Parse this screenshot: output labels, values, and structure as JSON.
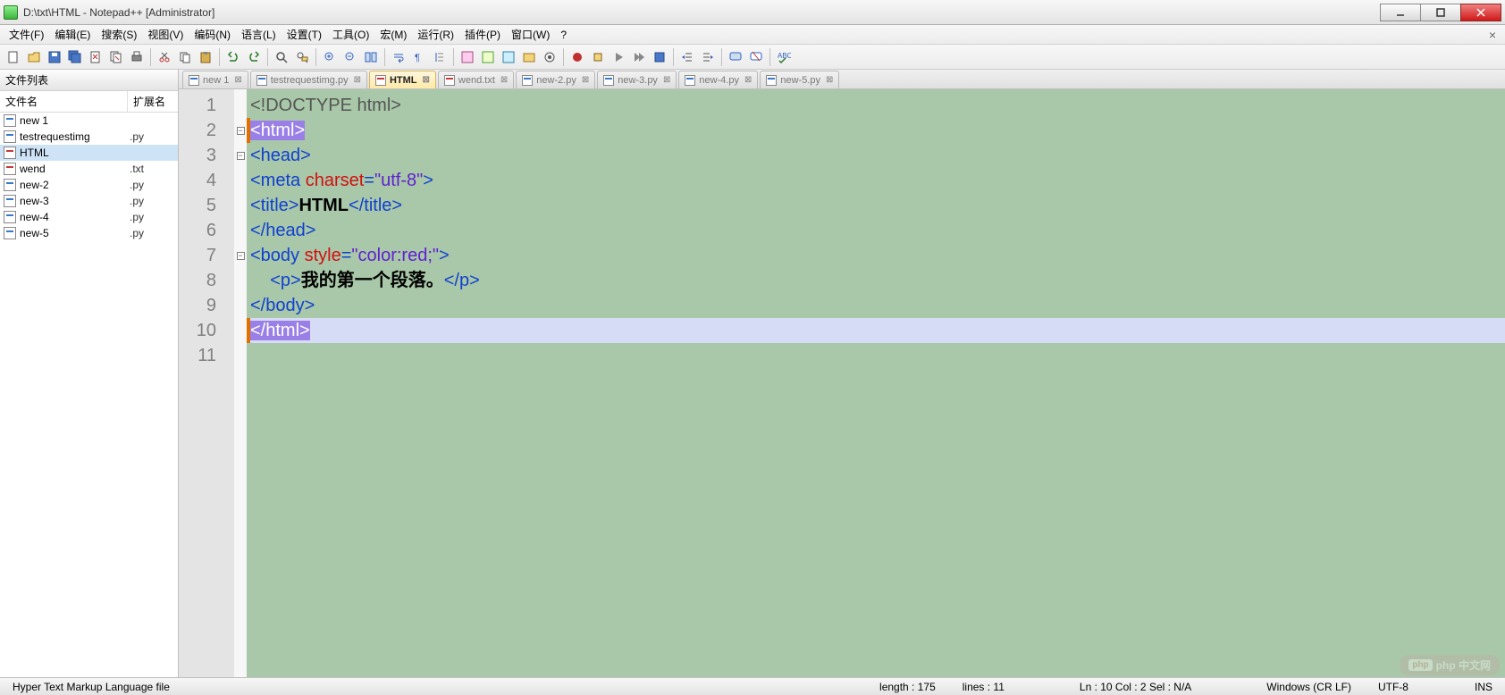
{
  "window": {
    "title": "D:\\txt\\HTML - Notepad++ [Administrator]"
  },
  "menu": [
    "文件(F)",
    "编辑(E)",
    "搜索(S)",
    "视图(V)",
    "编码(N)",
    "语言(L)",
    "设置(T)",
    "工具(O)",
    "宏(M)",
    "运行(R)",
    "插件(P)",
    "窗口(W)",
    "?"
  ],
  "sidebar": {
    "panel_title": "文件列表",
    "col_name": "文件名",
    "col_ext": "扩展名",
    "files": [
      {
        "name": "new 1",
        "ext": "",
        "type": "py",
        "selected": false
      },
      {
        "name": "testrequestimg",
        "ext": ".py",
        "type": "py",
        "selected": false
      },
      {
        "name": "HTML",
        "ext": "",
        "type": "txt",
        "selected": true
      },
      {
        "name": "wend",
        "ext": ".txt",
        "type": "txt",
        "selected": false
      },
      {
        "name": "new-2",
        "ext": ".py",
        "type": "py",
        "selected": false
      },
      {
        "name": "new-3",
        "ext": ".py",
        "type": "py",
        "selected": false
      },
      {
        "name": "new-4",
        "ext": ".py",
        "type": "py",
        "selected": false
      },
      {
        "name": "new-5",
        "ext": ".py",
        "type": "py",
        "selected": false
      }
    ]
  },
  "tabs": [
    {
      "label": "new 1",
      "type": "py",
      "active": false,
      "close": "⊠"
    },
    {
      "label": "testrequestimg.py",
      "type": "py",
      "active": false,
      "close": "⊠"
    },
    {
      "label": "HTML",
      "type": "txt",
      "active": true,
      "close": "⊠"
    },
    {
      "label": "wend.txt",
      "type": "txt",
      "active": false,
      "close": "⊠"
    },
    {
      "label": "new-2.py",
      "type": "py",
      "active": false,
      "close": "⊠"
    },
    {
      "label": "new-3.py",
      "type": "py",
      "active": false,
      "close": "⊠"
    },
    {
      "label": "new-4.py",
      "type": "py",
      "active": false,
      "close": "⊠"
    },
    {
      "label": "new-5.py",
      "type": "py",
      "active": false,
      "close": "⊠"
    }
  ],
  "code": {
    "lines": [
      {
        "n": "1",
        "html": "<span class='t-gray'>&lt;!DOCTYPE html&gt;</span>"
      },
      {
        "n": "2",
        "fold": true,
        "marker": true,
        "html": "<span class='hlpair'>&lt;</span><span class='t-blue' style='background:#9a80e6;color:#fff'>html</span><span class='hlpair'>&gt;</span>"
      },
      {
        "n": "3",
        "fold": true,
        "html": "<span class='t-blue'>&lt;head&gt;</span>"
      },
      {
        "n": "4",
        "html": "<span class='t-blue'>&lt;meta </span><span class='t-red'>charset</span><span class='t-blue'>=</span><span class='t-purple'>\"utf-8\"</span><span class='t-blue'>&gt;</span>"
      },
      {
        "n": "5",
        "html": "<span class='t-blue'>&lt;title&gt;</span><span class='t-black'>HTML</span><span class='t-blue'>&lt;/title&gt;</span>"
      },
      {
        "n": "6",
        "html": "<span class='t-blue'>&lt;/head&gt;</span>"
      },
      {
        "n": "7",
        "fold": true,
        "html": "<span class='t-blue'>&lt;body </span><span class='t-red'>style</span><span class='t-blue'>=</span><span class='t-purple'>\"color:red;\"</span><span class='t-blue'>&gt;</span>"
      },
      {
        "n": "8",
        "html": "    <span class='t-blue'>&lt;p&gt;</span><span class='t-black'>我的第一个段落。</span><span class='t-blue'>&lt;/p&gt;</span>"
      },
      {
        "n": "9",
        "html": "<span class='t-blue'>&lt;/body&gt;</span>"
      },
      {
        "n": "10",
        "hl": true,
        "marker": true,
        "html": "<span class='hlpair'>&lt;/</span><span style='background:#9a80e6;color:#fff'>html</span><span class='hlpair'>&gt;</span>"
      },
      {
        "n": "11",
        "html": ""
      }
    ]
  },
  "status": {
    "lang": "Hyper Text Markup Language file",
    "length": "length : 175",
    "lines": "lines : 11",
    "pos": "Ln : 10    Col : 2    Sel : N/A",
    "eol": "Windows (CR LF)",
    "enc": "UTF-8",
    "ins": "INS"
  },
  "watermark": "php 中文网"
}
